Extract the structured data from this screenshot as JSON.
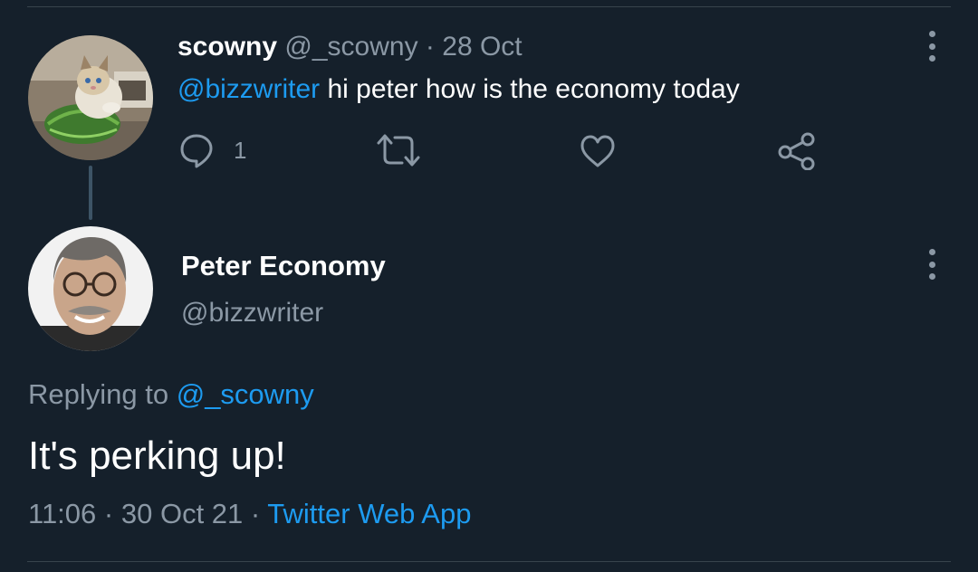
{
  "tweet1": {
    "display_name": "scowny",
    "handle": "@_scowny",
    "separator": "·",
    "date": "28 Oct",
    "mention": "@bizzwriter",
    "text": " hi peter how is the economy today",
    "reply_count": "1"
  },
  "tweet2": {
    "display_name": "Peter Economy",
    "handle": "@bizzwriter",
    "replying_prefix": "Replying to ",
    "replying_handle": "@_scowny",
    "text": "It's perking up!",
    "time": "11:06",
    "separator": "·",
    "date": "30 Oct 21",
    "source": "Twitter Web App"
  },
  "icons": {
    "reply": "reply-icon",
    "retweet": "retweet-icon",
    "like": "heart-icon",
    "share": "share-icon",
    "more": "more-vertical-icon"
  },
  "colors": {
    "background": "#15202b",
    "link": "#1d9bf0",
    "muted": "#8b98a5",
    "text": "#ffffff",
    "divider": "#38444d"
  }
}
